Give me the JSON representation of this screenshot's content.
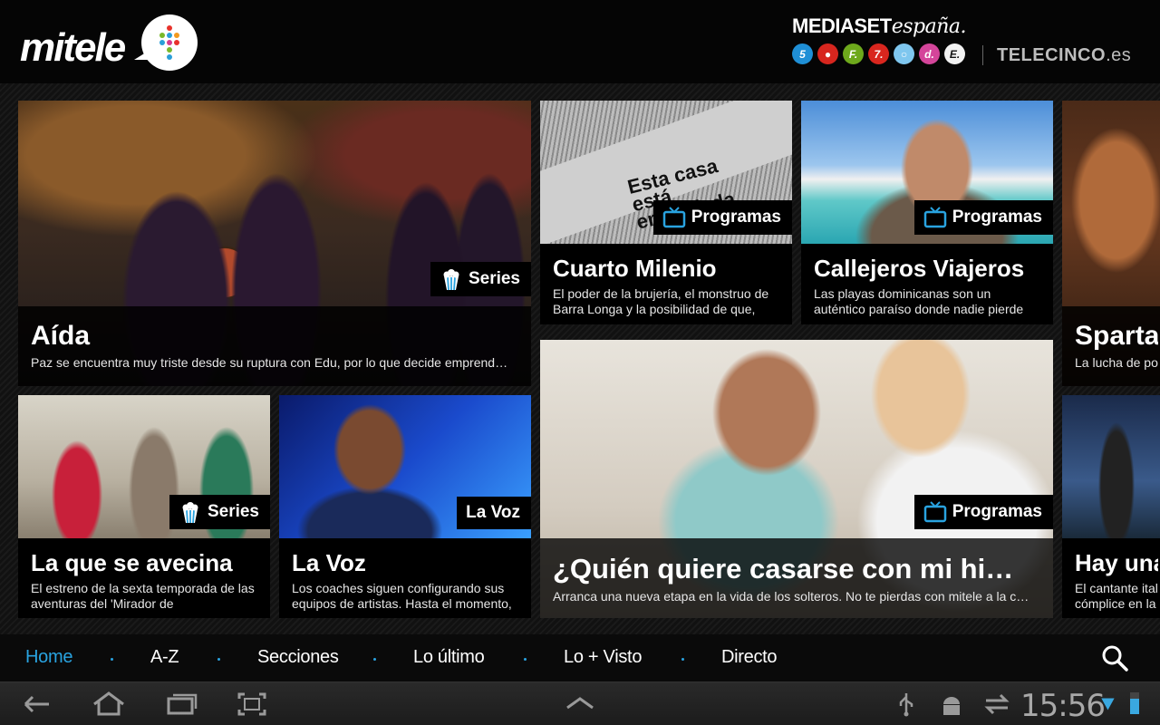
{
  "header": {
    "logo_text": "mitele",
    "brand_title": "MEDIASET",
    "brand_title_italic": "españa.",
    "channels": [
      {
        "label": "5",
        "color": "#1f8fd6"
      },
      {
        "label": "●",
        "color": "#d7261e"
      },
      {
        "label": "F.",
        "color": "#6ea91c"
      },
      {
        "label": "7.",
        "color": "#d9261e"
      },
      {
        "label": "○",
        "color": "#7fc7ef"
      },
      {
        "label": "d.",
        "color": "#d4459a"
      },
      {
        "label": "E.",
        "color": "#f2f2f2"
      }
    ],
    "telecinco": "TELECINCO",
    "telecinco_suffix": ".es"
  },
  "cards": {
    "aida": {
      "title": "Aída",
      "desc": "Paz se encuentra muy triste desde su ruptura con Edu, por lo que decide emprend…",
      "badge": "Series"
    },
    "cuarto": {
      "title": "Cuarto Milenio",
      "desc": "El poder de la brujería, el monstruo de Barra Longa y la posibilidad de que,",
      "badge": "Programas",
      "image_text": "Esta casa está embrujada"
    },
    "callejeros": {
      "title": "Callejeros Viajeros",
      "desc": "Las playas dominicanas son un auténtico paraíso donde nadie pierde",
      "badge": "Programas"
    },
    "spartacus": {
      "title": "Sparta",
      "desc": "La lucha de po"
    },
    "laque": {
      "title": "La que se avecina",
      "desc": "El estreno de la sexta temporada de las aventuras del 'Mirador de",
      "badge": "Series"
    },
    "lavoz": {
      "title": "La Voz",
      "desc": "Los coaches siguen configurando sus equipos de artistas. Hasta el momento,",
      "badge": "La Voz"
    },
    "quien": {
      "title": "¿Quién quiere casarse con mi hi…",
      "desc": "Arranca una nueva etapa en la vida de los solteros. No te pierdas con mitele a la c…",
      "badge": "Programas"
    },
    "hay": {
      "title": "Hay una",
      "desc": "El cantante ital cómplice en la"
    }
  },
  "nav": {
    "items": [
      "Home",
      "A-Z",
      "Secciones",
      "Lo último",
      "Lo + Visto",
      "Directo"
    ],
    "accent": "#29a3e0"
  },
  "system": {
    "clock": "15:56"
  }
}
